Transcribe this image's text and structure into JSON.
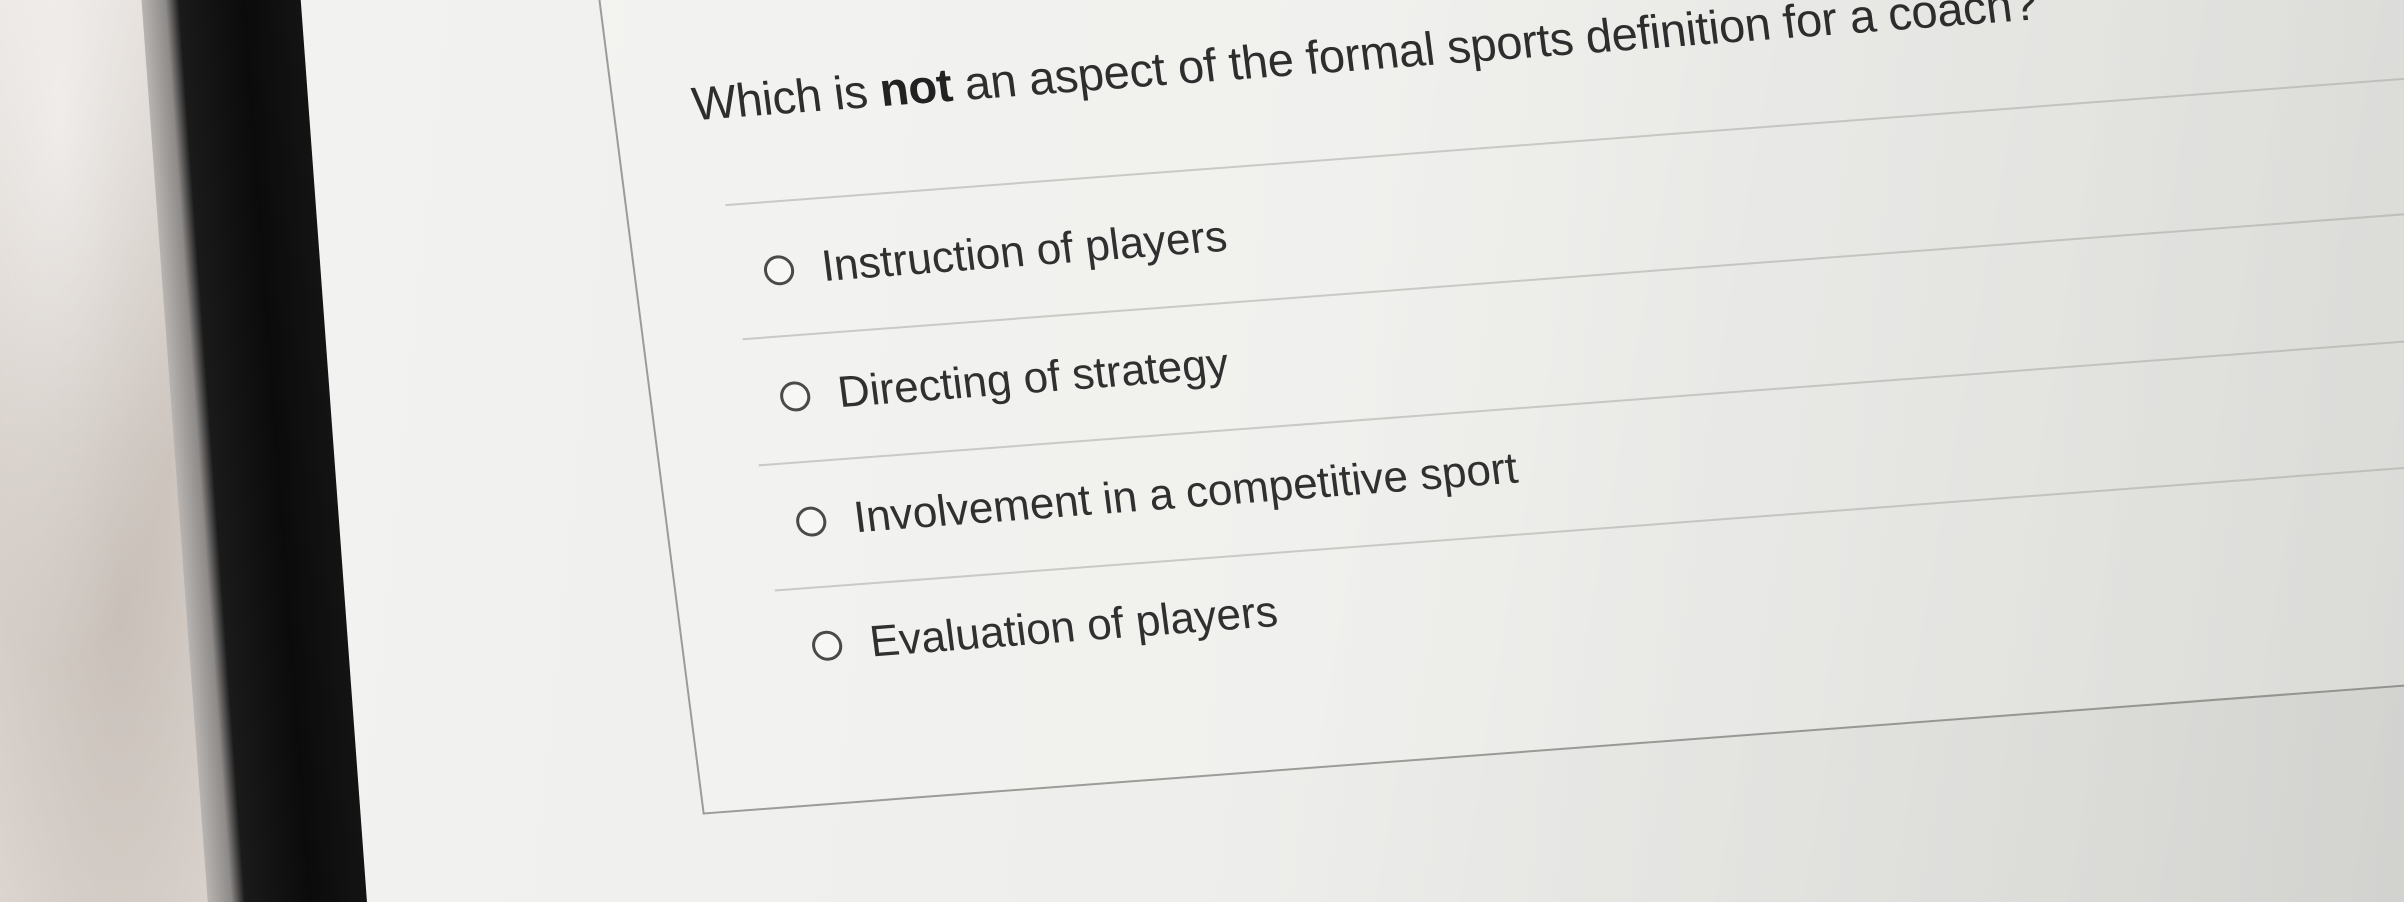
{
  "question": {
    "prefix": "Which is ",
    "emphasis": "not",
    "suffix": " an aspect of the formal sports definition for a coach?"
  },
  "options": [
    {
      "label": "Instruction of players",
      "selected": false
    },
    {
      "label": "Directing of strategy",
      "selected": false
    },
    {
      "label": "Involvement in a competitive sport",
      "selected": false
    },
    {
      "label": "Evaluation of players",
      "selected": false
    }
  ],
  "colors": {
    "text": "#2e2e2e",
    "radio_border": "#4a4a4a",
    "divider": "#c9c9c6",
    "panel_border": "#9b9b98"
  }
}
